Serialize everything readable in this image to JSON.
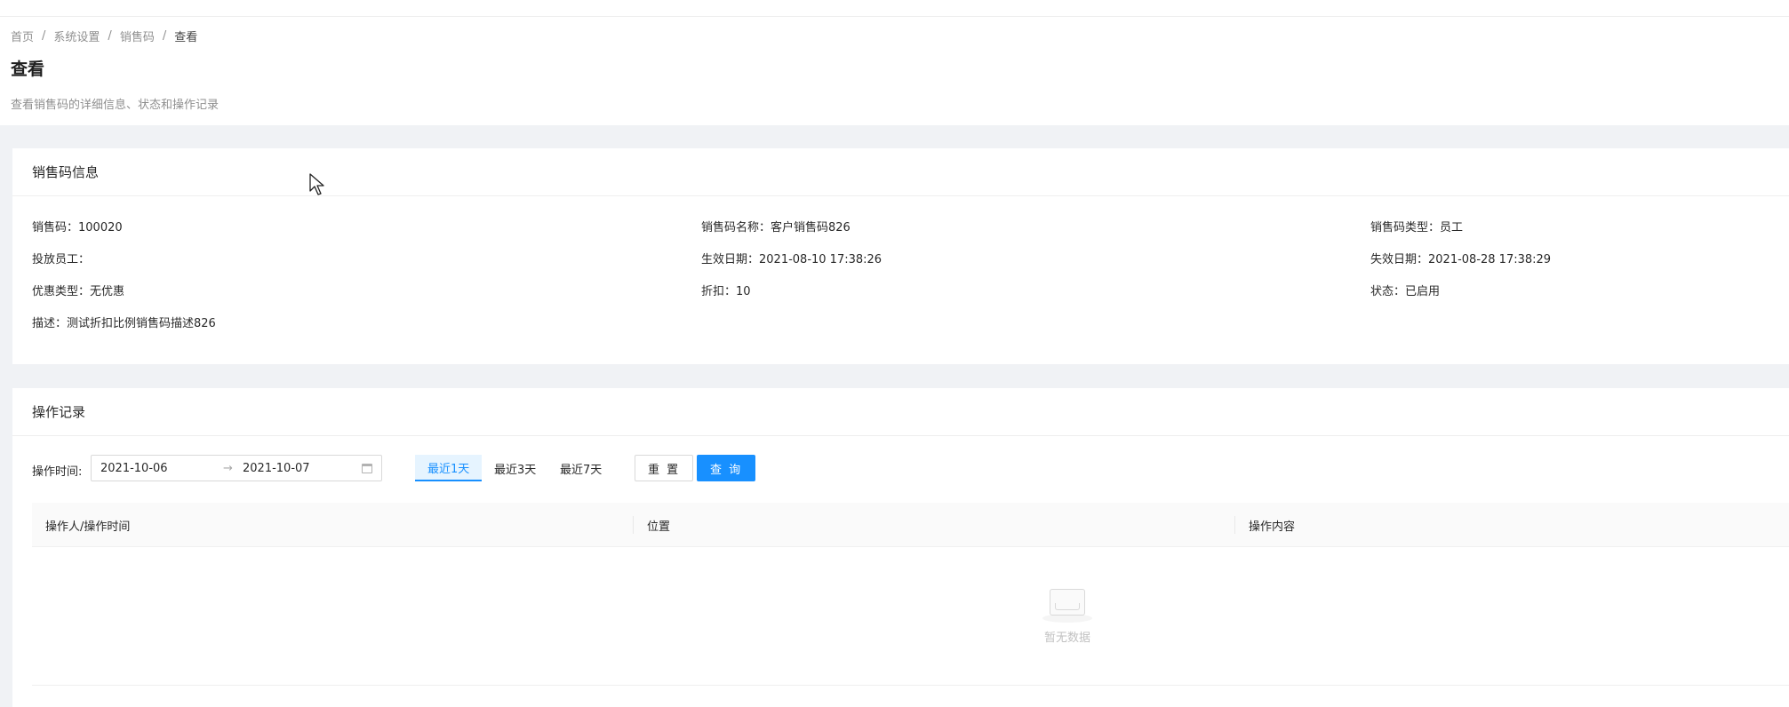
{
  "breadcrumb": {
    "items": [
      "首页",
      "系统设置",
      "销售码",
      "查看"
    ],
    "separator": "/"
  },
  "page": {
    "title": "查看",
    "description": "查看销售码的详细信息、状态和操作记录"
  },
  "info_card": {
    "title": "销售码信息",
    "fields": {
      "code": "销售码：100020",
      "name": "销售码名称：客户销售码826",
      "type": "销售码类型：员工",
      "employee": "投放员工：",
      "start_date": "生效日期：2021-08-10 17:38:26",
      "end_date": "失效日期：2021-08-28 17:38:29",
      "discount_type": "优惠类型：无优惠",
      "discount": "折扣：10",
      "status": "状态：已启用",
      "description": "描述：测试折扣比例销售码描述826"
    }
  },
  "log_card": {
    "title": "操作记录",
    "filter": {
      "label": "操作时间:",
      "start_date": "2021-10-06",
      "end_date": "2021-10-07",
      "arrow": "→",
      "quick_ranges": [
        "最近1天",
        "最近3天",
        "最近7天"
      ],
      "active_range": "最近1天",
      "reset_label": "重 置",
      "query_label": "查 询"
    },
    "table": {
      "columns": [
        "操作人/操作时间",
        "位置",
        "操作内容"
      ],
      "rows": [],
      "empty_text": "暂无数据"
    }
  },
  "colors": {
    "primary": "#1890ff",
    "page_background": "#f0f2f5"
  }
}
